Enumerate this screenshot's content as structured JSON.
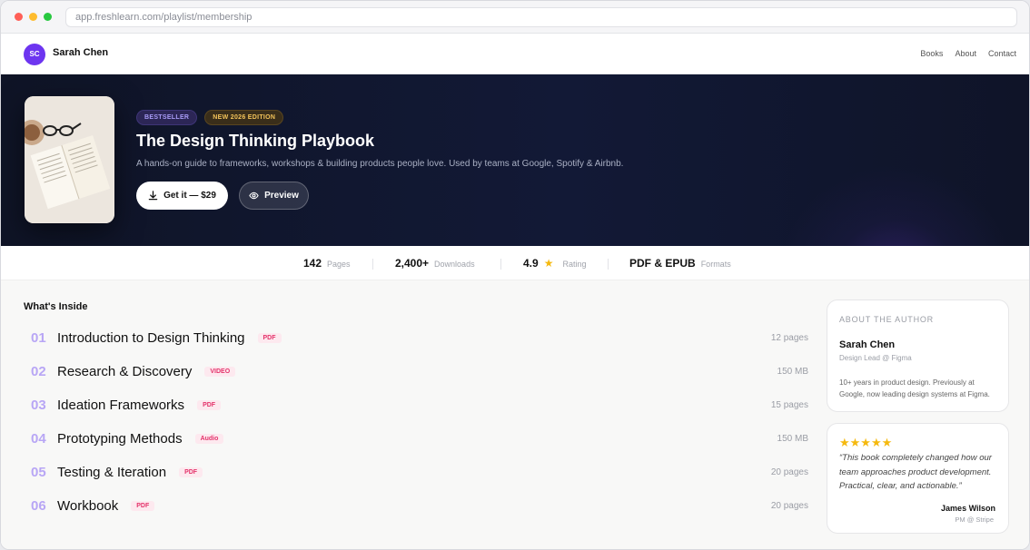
{
  "browser": {
    "url": "app.freshlearn.com/playlist/membership"
  },
  "navbar": {
    "avatar_initials": "SC",
    "brand_name": "Sarah Chen",
    "links": [
      "Books",
      "About",
      "Contact"
    ]
  },
  "hero": {
    "badges": [
      "BESTSELLER",
      "NEW 2026 EDITION"
    ],
    "title": "The Design Thinking Playbook",
    "subtitle": "A hands-on guide to frameworks, workshops & building products people love. Used by teams at Google, Spotify & Airbnb.",
    "primary_button": "Get it — $29",
    "secondary_button": "Preview"
  },
  "stats": [
    {
      "value": "142",
      "label": "Pages"
    },
    {
      "value": "2,400+",
      "label": "Downloads"
    },
    {
      "value": "4.9",
      "label": "Rating",
      "icon": "star-icon"
    },
    {
      "value": "PDF & EPUB",
      "label": "Formats"
    }
  ],
  "contents": {
    "title": "What's Inside",
    "items": [
      {
        "num": "01",
        "title": "Introduction to Design Thinking",
        "tag": "PDF",
        "meta": "12 pages"
      },
      {
        "num": "02",
        "title": "Research & Discovery",
        "tag": "VIDEO",
        "meta": "150 MB"
      },
      {
        "num": "03",
        "title": "Ideation Frameworks",
        "tag": "PDF",
        "meta": "15 pages"
      },
      {
        "num": "04",
        "title": "Prototyping Methods",
        "tag": "Audio",
        "meta": "150 MB"
      },
      {
        "num": "05",
        "title": "Testing & Iteration",
        "tag": "PDF",
        "meta": "20 pages"
      },
      {
        "num": "06",
        "title": "Workbook",
        "tag": "PDF",
        "meta": "20 pages"
      }
    ]
  },
  "author": {
    "heading": "ABOUT THE AUTHOR",
    "name": "Sarah Chen",
    "role": "Design Lead @ Figma",
    "bio": "10+ years in product design. Previously at Google, now leading design systems at Figma."
  },
  "review": {
    "stars": "★★★★★",
    "quote": "“This book completely changed how our team approaches product development. Practical, clear, and actionable.”",
    "name": "James Wilson",
    "role": "PM @ Stripe"
  },
  "colors": {
    "accent": "#6d35f0",
    "number_color": "#b8a6f5",
    "tag_color": "#e4336b",
    "star_color": "#f5b90f"
  }
}
